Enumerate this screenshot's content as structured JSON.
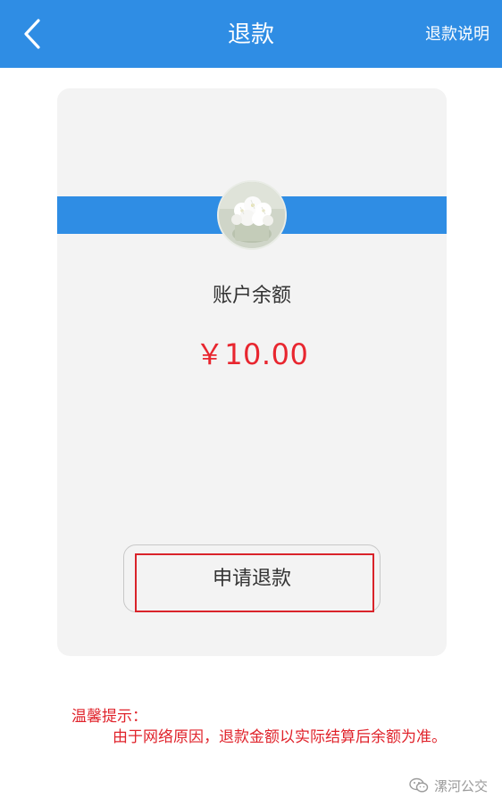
{
  "header": {
    "back_icon": "chevron-left-icon",
    "title": "退款",
    "right_link": "退款说明",
    "background_color": "#2f8de4"
  },
  "account_card": {
    "avatar_image": "white flower bouquet in a pot",
    "balance_label": "账户余额",
    "balance_amount": "￥10.00",
    "amount_color": "#e8262f",
    "refund_button_label": "申请退款"
  },
  "tips": {
    "title": "温馨提示：",
    "body": "由于网络原因，退款金额以实际结算后余额为准。",
    "color": "#e0232b"
  },
  "watermark": {
    "icon": "wechat-icon",
    "text": "漯河公交"
  }
}
